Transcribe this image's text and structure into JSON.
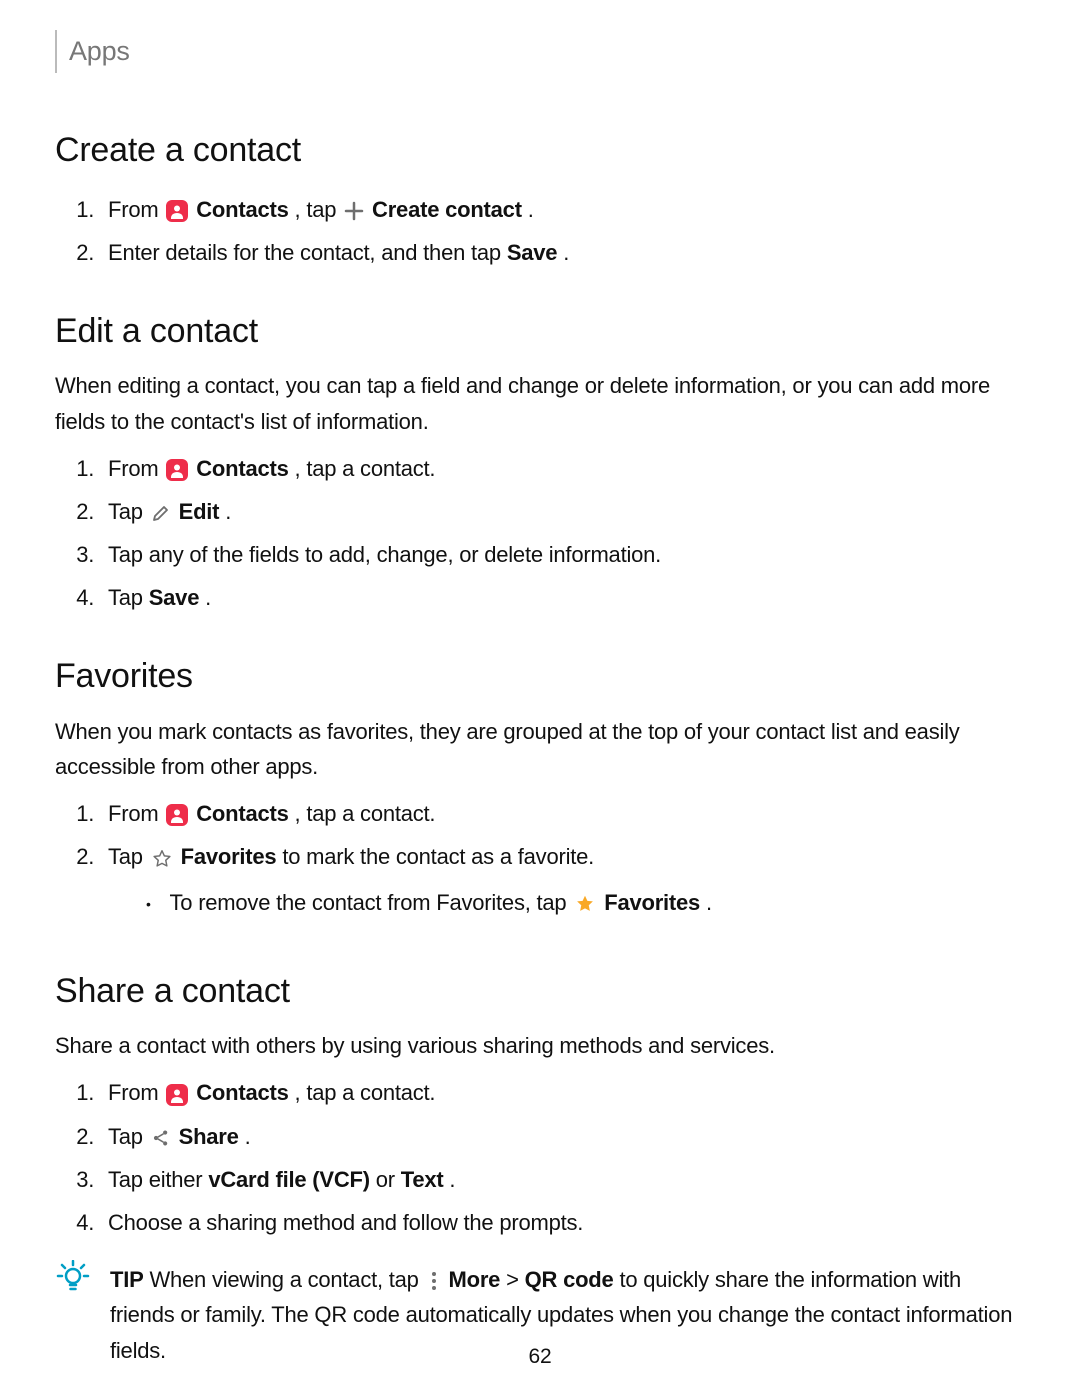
{
  "header": "Apps",
  "pageNumber": "62",
  "sections": {
    "create": {
      "title": "Create a contact",
      "step1_from": "From ",
      "step1_contacts": "Contacts",
      "step1_tap": ", tap ",
      "step1_createcontact": "Create contact",
      "step1_end": ".",
      "step2_a": "Enter details for the contact, and then tap ",
      "step2_save": "Save",
      "step2_b": "."
    },
    "edit": {
      "title": "Edit a contact",
      "desc": "When editing a contact, you can tap a field and change or delete information, or you can add more fields to the contact's list of information.",
      "step1_from": "From ",
      "step1_contacts": "Contacts",
      "step1_end": ", tap a contact.",
      "step2_tap": "Tap ",
      "step2_edit": "Edit",
      "step2_end": ".",
      "step3": "Tap any of the fields to add, change, or delete information.",
      "step4_tap": "Tap ",
      "step4_save": "Save",
      "step4_end": "."
    },
    "favorites": {
      "title": "Favorites",
      "desc": "When you mark contacts as favorites, they are grouped at the top of your contact list and easily accessible from other apps.",
      "step1_from": "From ",
      "step1_contacts": "Contacts",
      "step1_end": ", tap a contact.",
      "step2_tap": "Tap ",
      "step2_fav": "Favorites",
      "step2_end": " to mark the contact as a favorite.",
      "sub_a": "To remove the contact from Favorites, tap ",
      "sub_fav": "Favorites",
      "sub_end": "."
    },
    "share": {
      "title": "Share a contact",
      "desc": "Share a contact with others by using various sharing methods and services.",
      "step1_from": "From ",
      "step1_contacts": "Contacts",
      "step1_end": ", tap a contact.",
      "step2_tap": "Tap ",
      "step2_share": "Share",
      "step2_end": ".",
      "step3_a": "Tap either ",
      "step3_vcf": "vCard file (VCF)",
      "step3_or": " or ",
      "step3_text": "Text",
      "step3_end": ".",
      "step4": "Choose a sharing method and follow the prompts."
    },
    "tip": {
      "tipLabel": "TIP",
      "a": " When viewing a contact, tap ",
      "more": "More",
      "gt": " > ",
      "qr": "QR code",
      "b": " to quickly share the information with friends or family. The QR code automatically updates when you change the contact information fields."
    }
  }
}
